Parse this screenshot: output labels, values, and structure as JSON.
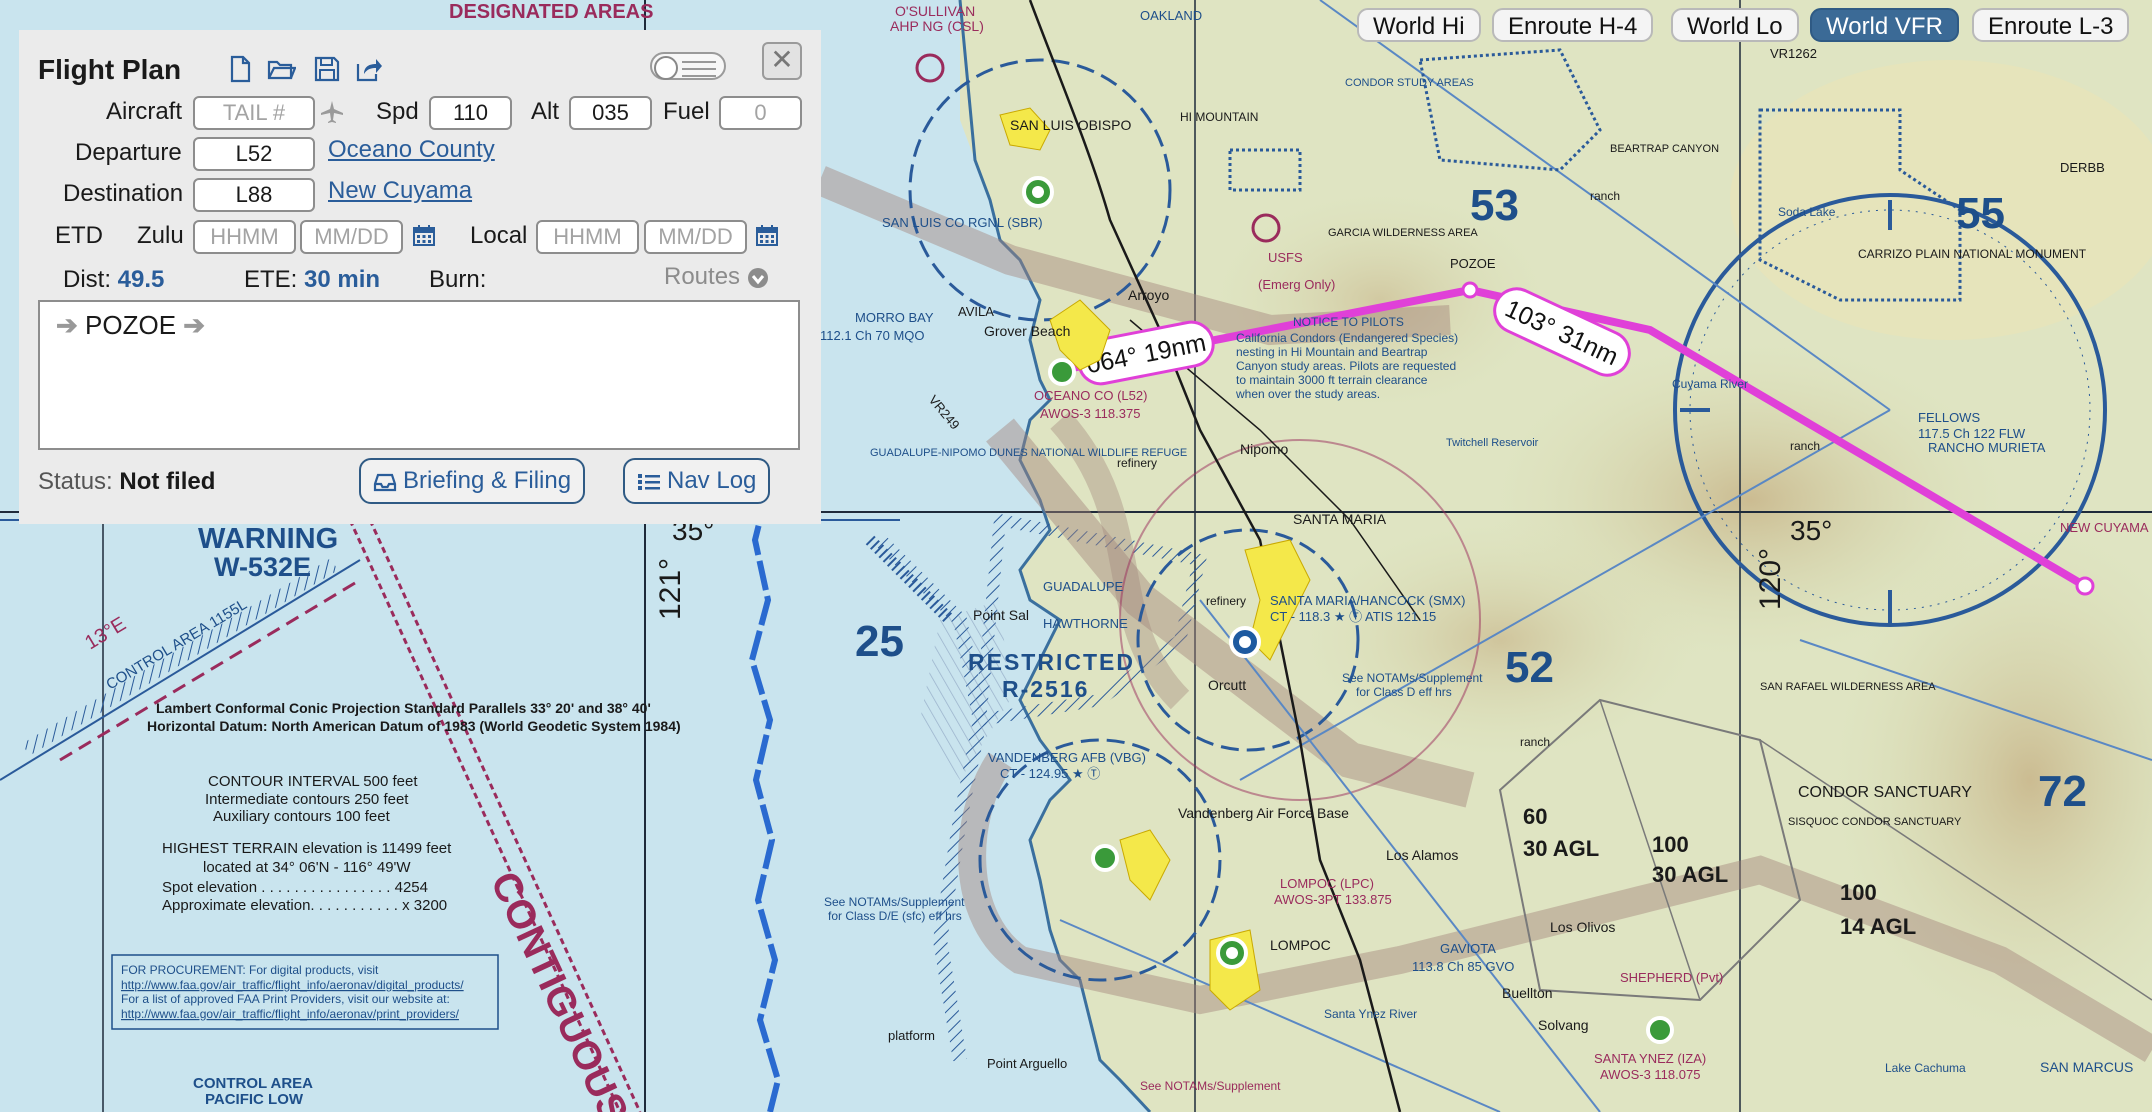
{
  "chart_tabs": [
    {
      "label": "World Hi",
      "active": false
    },
    {
      "label": "Enroute H-4",
      "active": false
    },
    {
      "label": "World Lo",
      "active": false
    },
    {
      "label": "World VFR",
      "active": true
    },
    {
      "label": "Enroute L-3",
      "active": false
    }
  ],
  "flight_plan": {
    "title": "Flight Plan",
    "aircraft_label": "Aircraft",
    "aircraft_placeholder": "TAIL #",
    "spd_label": "Spd",
    "spd_value": "110",
    "alt_label": "Alt",
    "alt_value": "035",
    "fuel_label": "Fuel",
    "fuel_placeholder": "0",
    "departure_label": "Departure",
    "departure_value": "L52",
    "departure_name": "Oceano County",
    "destination_label": "Destination",
    "destination_value": "L88",
    "destination_name": "New Cuyama",
    "etd_label": "ETD",
    "zulu_label": "Zulu",
    "local_label": "Local",
    "time_placeholder": "HHMM",
    "date_placeholder": "MM/DD",
    "dist_label": "Dist:",
    "dist_value": "49.5",
    "ete_label": "ETE:",
    "ete_value": "30 min",
    "burn_label": "Burn:",
    "routes_label": "Routes",
    "route_waypoint": "POZOE",
    "status_label": "Status:",
    "status_value": "Not filed",
    "briefing_button": "Briefing & Filing",
    "navlog_button": "Nav Log"
  },
  "route_legs": [
    {
      "label": "064° 19nm"
    },
    {
      "label": "103° 31nm"
    }
  ],
  "map_labels": {
    "designated_areas": "DESIGNATED AREAS",
    "warning": "WARNING",
    "warning_id": "W-532E",
    "restricted": "RESTRICTED",
    "restricted_id": "R-2516",
    "grid_25": "25",
    "grid_52": "52",
    "grid_53": "53",
    "grid_55": "55",
    "grid_72": "72",
    "lat_35": "35°",
    "lon_121": "121°",
    "lon_120": "120°",
    "contiguous": "CONTIGUOUS",
    "control_area": "CONTROL AREA",
    "pacific_low": "PACIFIC LOW",
    "control_area_1155l": "CONTROL AREA 1155L",
    "var_13e": "13°E",
    "projection_note": "Lambert Conformal Conic Projection Standard Parallels 33° 20' and 38° 40'",
    "datum_note": "Horizontal Datum: North American Datum of 1983 (World Geodetic System 1984)",
    "contour_interval": "CONTOUR INTERVAL 500 feet",
    "intermediate_contours": "Intermediate contours 250 feet",
    "auxiliary_contours": "Auxiliary contours 100 feet",
    "highest_terrain": "HIGHEST TERRAIN elevation is 11499 feet",
    "terrain_location": "located at 34° 06'N - 116° 49'W",
    "spot_elevation": "Spot elevation . . . . . . . . . . . . . . . . 4254",
    "approx_elevation": "Approximate elevation. . . . . . . . . . . x 3200",
    "procurement_1": "FOR PROCUREMENT:  For digital products, visit",
    "procurement_2": "http://www.faa.gov/air_traffic/flight_info/aeronav/digital_products/",
    "procurement_3": "For a list of approved FAA Print Providers, visit our website at:",
    "procurement_4": "http://www.faa.gov/air_traffic/flight_info/aeronav/print_providers/",
    "san_luis_obispo": "SAN LUIS OBISPO",
    "slo_airport": "SAN LUIS CO RGNL (SBR)",
    "oceano": "OCEANO CO (L52)",
    "oceano_freq": "AWOS-3 118.375",
    "grover_beach": "Grover Beach",
    "arroyo": "Arroyo",
    "nipomo": "Nipomo",
    "santa_maria": "SANTA MARIA",
    "smx_airport": "SANTA MARIA/HANCOCK (SMX)",
    "smx_freq": "CT - 118.3 ★ Ⓣ ATIS 121.15",
    "guadalupe": "GUADALUPE",
    "hawthorne": "HAWTHORNE",
    "point_sal": "Point Sal",
    "orcutt": "Orcutt",
    "vandenberg": "VANDENBERG AFB (VBG)",
    "vbg_freq": "CT - 124.95 ★ Ⓣ",
    "vandenberg_afb": "Vandenberg Air Force Base",
    "lompoc_airport": "LOMPOC (LPC)",
    "lompoc_freq": "AWOS-3PT  133.875",
    "lompoc": "LOMPOC",
    "los_alamos": "Los Alamos",
    "gaviota": "GAVIOTA",
    "gaviota_freq": "113.8 Ch 85 GVO",
    "buellton": "Buellton",
    "solvang": "Solvang",
    "los_olivos": "Los Olivos",
    "santa_ynez": "SANTA YNEZ (IZA)",
    "santa_ynez_freq": "AWOS-3 118.075",
    "shepherd": "SHEPHERD (Pvt)",
    "new_cuyama": "NEW CUYAMA",
    "fellows": "FELLOWS",
    "fellows_freq": "117.5 Ch 122 FLW",
    "rancho_murieta": "RANCHO MURIETA",
    "carrizo": "CARRIZO PLAIN NATIONAL MONUMENT",
    "condor_sanctuary": "CONDOR SANCTUARY",
    "sisquoc": "SISQUOC CONDOR SANCTUARY",
    "san_rafael": "SAN RAFAEL WILDERNESS AREA",
    "garcia": "GARCIA WILDERNESS AREA",
    "pozoe": "POZOE",
    "morro_bay": "MORRO BAY",
    "morro_freq": "112.1 Ch 70 MQO",
    "avila": "AVILA",
    "guadalupe_dunes": "GUADALUPE-NIPOMO DUNES NATIONAL WILDLIFE REFUGE",
    "notice_title": "NOTICE TO PILOTS",
    "notice_1": "California Condors (Endangered Species)",
    "notice_2": "nesting in Hi Mountain and Beartrap",
    "notice_3": "Canyon study areas. Pilots are requested",
    "notice_4": "to maintain 3000 ft terrain clearance",
    "notice_5": "when over the study areas.",
    "see_notams": "See NOTAMs/Supplement",
    "class_de": "for Class D/E (sfc) eff hrs",
    "class_d": "for Class D eff hrs",
    "agl_60": "60",
    "agl_30": "30 AGL",
    "agl_100a": "100",
    "agl_30b": "30 AGL",
    "agl_100b": "100",
    "agl_14": "14 AGL",
    "oakland": "OAKLAND",
    "osullivan": "O'SULLIVAN",
    "ahp_ng": "AHP NG (CSL)",
    "usfs": "USFS",
    "usfs_note": "(Emerg Only)",
    "hi_mountain": "HI MOUNTAIN",
    "condor_study": "CONDOR STUDY AREAS",
    "beartrap": "BEARTRAP CANYON",
    "soda_lake": "Soda Lake",
    "derbb": "DERBB",
    "vr1262": "VR1262",
    "vr249": "VR249",
    "platform": "platform",
    "point_arguello": "Point Arguello",
    "san_marcus": "SAN MARCUS",
    "twitchell": "Twitchell Reservoir",
    "refinery": "refinery",
    "ranch": "ranch",
    "santa_ynez_river": "Santa Ynez River",
    "cuyama_river": "Cuyama River",
    "lake_cachuma": "Lake Cachuma",
    "wilderness": "WILDERNESS AREA"
  },
  "colors": {
    "water": "#c9e4ee",
    "land": "#dfe4c2",
    "route_magenta": "#e040d8",
    "chart_blue": "#1e4f8a",
    "chart_magenta": "#9a2b5c",
    "active_tab": "#3b6a96"
  }
}
